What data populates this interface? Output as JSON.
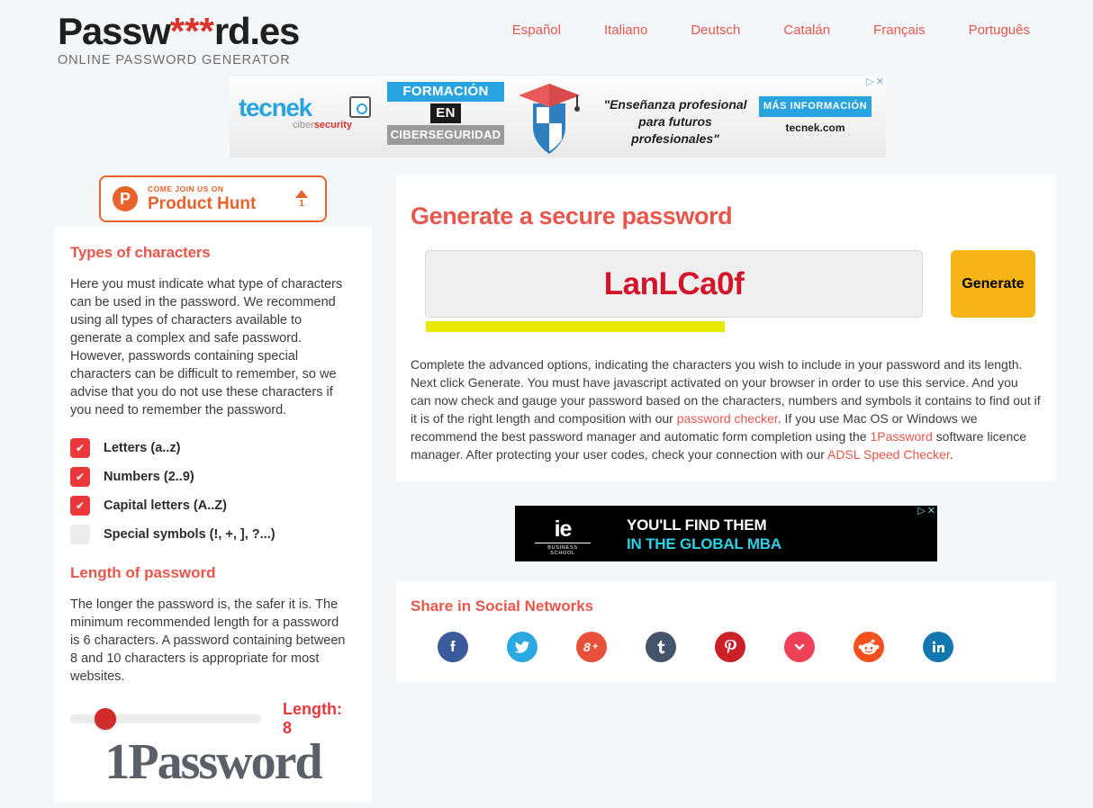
{
  "header": {
    "logo_main_pre": "Passw",
    "logo_asterisks": "***",
    "logo_main_post": "rd.es",
    "logo_sub": "ONLINE PASSWORD GENERATOR",
    "nav": [
      {
        "label": "Español"
      },
      {
        "label": "Italiano"
      },
      {
        "label": "Deutsch"
      },
      {
        "label": "Catalán"
      },
      {
        "label": "Français"
      },
      {
        "label": "Português"
      }
    ]
  },
  "ad_top": {
    "brand": "tecnek",
    "brand_tag_1": "ciber",
    "brand_tag_2": "security",
    "line1": "FORMACIÓN",
    "line2": "EN",
    "line3": "CIBERSEGURIDAD",
    "quote": "\"Enseñanza profesional para futuros profesionales\"",
    "cta": "MÁS INFORMACIÓN",
    "url": "tecnek.com",
    "adchoices_icon": "adchoices-icon",
    "close_icon": "close-icon"
  },
  "product_hunt": {
    "small": "COME JOIN US ON",
    "big": "Product Hunt",
    "votes": "1"
  },
  "sidebar": {
    "types_title": "Types of characters",
    "types_text": "Here you must indicate what type of characters can be used in the password. We recommend using all types of characters available to generate a complex and safe password. However, passwords containing special characters can be difficult to remember, so we advise that you do not use these characters if you need to remember the password.",
    "options": [
      {
        "label": "Letters (a..z)",
        "checked": true
      },
      {
        "label": "Numbers (2..9)",
        "checked": true
      },
      {
        "label": "Capital letters (A..Z)",
        "checked": true
      },
      {
        "label": "Special symbols (!, +, ], ?...)",
        "checked": false
      }
    ],
    "length_title": "Length of password",
    "length_text": "The longer the password is, the safer it is. The minimum recommended length for a password is 6 characters. A password containing between 8 and 10 characters is appropriate for most websites.",
    "length_label": "Length: 8",
    "slider_value": 8,
    "slider_min": 6,
    "slider_max": 20,
    "onepassword_logo": "1Password"
  },
  "main": {
    "heading": "Generate a secure password",
    "password_value": "LanLCa0f",
    "strength_percent": 60,
    "generate_label": "Generate",
    "paragraph_1": "Complete the advanced options, indicating the characters you wish to include in your password and its length. Next click Generate. You must have javascript activated on your browser in order to use this service. And you can now check and gauge your password based on the characters, numbers and symbols it contains to find out if it is of the right length and composition with our ",
    "link_1": "password checker",
    "paragraph_2": ". If you use Mac OS or Windows we recommend the best password manager and automatic form completion using the ",
    "link_2": "1Password",
    "paragraph_3": " software licence manager. After protecting your user codes, check your connection with our ",
    "link_3": "ADSL Speed Checker",
    "paragraph_4": "."
  },
  "ad_ie": {
    "logo": "ie",
    "logo_sub": "BUSINESS SCHOOL",
    "line1": "YOU'LL FIND THEM",
    "line2": "IN THE GLOBAL MBA",
    "adchoices_icon": "adchoices-icon",
    "close_icon": "close-icon"
  },
  "social": {
    "heading": "Share in Social Networks",
    "items": [
      {
        "name": "facebook",
        "color": "#3b5a9b"
      },
      {
        "name": "twitter",
        "color": "#2aa9e0"
      },
      {
        "name": "googleplus",
        "color": "#e8503a"
      },
      {
        "name": "tumblr",
        "color": "#44546b"
      },
      {
        "name": "pinterest",
        "color": "#cb2027"
      },
      {
        "name": "pocket",
        "color": "#ee4056"
      },
      {
        "name": "reddit",
        "color": "#f4501e"
      },
      {
        "name": "linkedin",
        "color": "#1277b0"
      }
    ]
  },
  "colors": {
    "accent_red": "#e8564c",
    "checkbox_red": "#e8383a",
    "generate_amber": "#f7b416",
    "strength_yellow": "#e8e800",
    "page_bg": "#f4f7fa"
  }
}
